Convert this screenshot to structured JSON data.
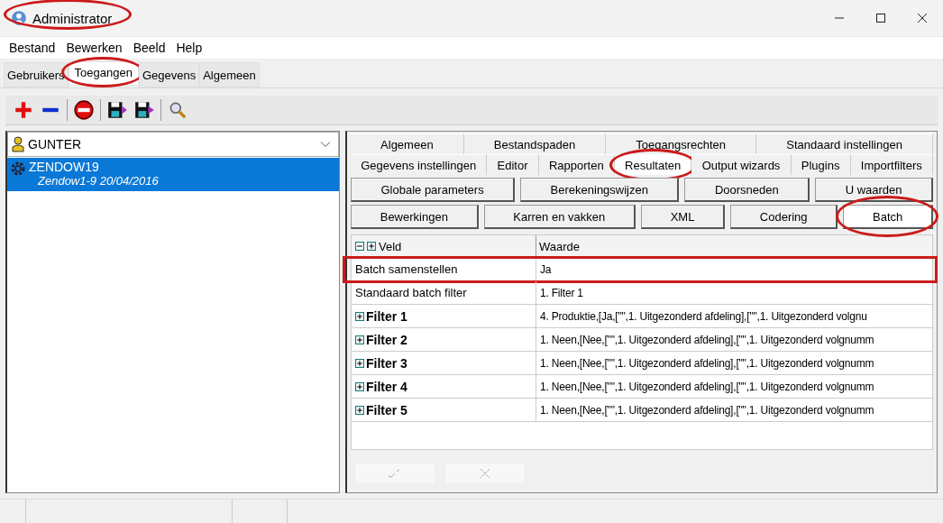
{
  "window": {
    "title": "Administrator",
    "circled": true
  },
  "menu": [
    "Bestand",
    "Bewerken",
    "Beeld",
    "Help"
  ],
  "main_tabs": [
    {
      "label": "Gebruikers",
      "selected": false,
      "circled": false
    },
    {
      "label": "Toegangen",
      "selected": true,
      "circled": true
    },
    {
      "label": "Gegevens",
      "selected": false,
      "circled": false
    },
    {
      "label": "Algemeen",
      "selected": false,
      "circled": false
    }
  ],
  "user_select": {
    "value": "GUNTER"
  },
  "users": [
    {
      "name": "ZENDOW19",
      "detail": "Zendow1-9 20/04/2016",
      "selected": true
    }
  ],
  "settings_tabs": [
    [
      {
        "label": "Algemeen",
        "selected": false,
        "circled": false
      },
      {
        "label": "Bestandspaden",
        "selected": false,
        "circled": false
      },
      {
        "label": "Toegangsrechten",
        "selected": false,
        "circled": false
      },
      {
        "label": "Standaard instellingen",
        "selected": false,
        "circled": false
      }
    ],
    [
      {
        "label": "Gegevens instellingen",
        "selected": false,
        "circled": false
      },
      {
        "label": "Editor",
        "selected": false,
        "circled": false
      },
      {
        "label": "Rapporten",
        "selected": false,
        "circled": false
      },
      {
        "label": "Resultaten",
        "selected": true,
        "circled": true
      },
      {
        "label": "Output wizards",
        "selected": false,
        "circled": false
      },
      {
        "label": "Plugins",
        "selected": false,
        "circled": false
      },
      {
        "label": "Importfilters",
        "selected": false,
        "circled": false
      }
    ]
  ],
  "section_buttons": [
    [
      {
        "label": "Globale parameters",
        "selected": false,
        "circled": false
      },
      {
        "label": "Berekeningswijzen",
        "selected": false,
        "circled": false
      },
      {
        "label": "Doorsneden",
        "selected": false,
        "circled": false
      },
      {
        "label": "U waarden",
        "selected": false,
        "circled": false
      }
    ],
    [
      {
        "label": "Bewerkingen",
        "selected": false,
        "circled": false
      },
      {
        "label": "Karren en vakken",
        "selected": false,
        "circled": false
      },
      {
        "label": "XML",
        "selected": false,
        "circled": false
      },
      {
        "label": "Codering",
        "selected": false,
        "circled": false
      },
      {
        "label": "Batch",
        "selected": true,
        "circled": true
      }
    ]
  ],
  "grid": {
    "columns": [
      "Veld",
      "Waarde"
    ],
    "rows": [
      {
        "field": "Batch samenstellen",
        "value": "Ja",
        "expandable": false,
        "boxed": true
      },
      {
        "field": "Standaard batch filter",
        "value": "1. Filter 1",
        "expandable": false,
        "boxed": false
      },
      {
        "field": "Filter 1",
        "value": "4. Produktie,[Ja,[\"\",1. Uitgezonderd afdeling],[\"\",1. Uitgezonderd volgnu",
        "expandable": true,
        "boxed": false
      },
      {
        "field": "Filter 2",
        "value": "1. Neen,[Nee,[\"\",1. Uitgezonderd afdeling],[\"\",1. Uitgezonderd volgnumm",
        "expandable": true,
        "boxed": false
      },
      {
        "field": "Filter 3",
        "value": "1. Neen,[Nee,[\"\",1. Uitgezonderd afdeling],[\"\",1. Uitgezonderd volgnumm",
        "expandable": true,
        "boxed": false
      },
      {
        "field": "Filter 4",
        "value": "1. Neen,[Nee,[\"\",1. Uitgezonderd afdeling],[\"\",1. Uitgezonderd volgnumm",
        "expandable": true,
        "boxed": false
      },
      {
        "field": "Filter 5",
        "value": "1. Neen,[Nee,[\"\",1. Uitgezonderd afdeling],[\"\",1. Uitgezonderd volgnumm",
        "expandable": true,
        "boxed": false
      }
    ]
  },
  "actions": [
    {
      "kind": "confirm",
      "disabled": true
    },
    {
      "kind": "cancel",
      "disabled": true
    }
  ]
}
